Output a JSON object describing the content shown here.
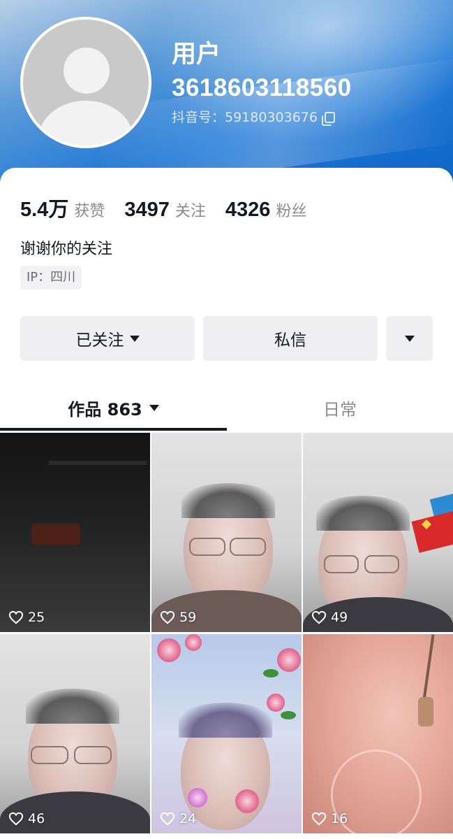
{
  "profile": {
    "name_line1": "用户",
    "name_line2": "3618603118560",
    "douyin_id": "抖音号：59180303676",
    "avatar_icon": "default-avatar-icon"
  },
  "stats": [
    {
      "value": "5.4万",
      "label": "获赞"
    },
    {
      "value": "3497",
      "label": "关注"
    },
    {
      "value": "4326",
      "label": "粉丝"
    }
  ],
  "bio": "谢谢你的关注",
  "ip": "IP：四川",
  "actions": {
    "follow_label": "已关注",
    "message_label": "私信"
  },
  "tabs": [
    {
      "label": "作品 863",
      "active": true
    },
    {
      "label": "日常",
      "active": false
    }
  ],
  "videos": [
    {
      "likes": "25"
    },
    {
      "likes": "59"
    },
    {
      "likes": "49"
    },
    {
      "likes": "46"
    },
    {
      "likes": "24"
    },
    {
      "likes": "16"
    }
  ],
  "colors": {
    "header_blue": "#1f78d6",
    "text_primary": "#161823",
    "text_secondary": "#8a8b91",
    "button_bg": "#efeff1"
  }
}
